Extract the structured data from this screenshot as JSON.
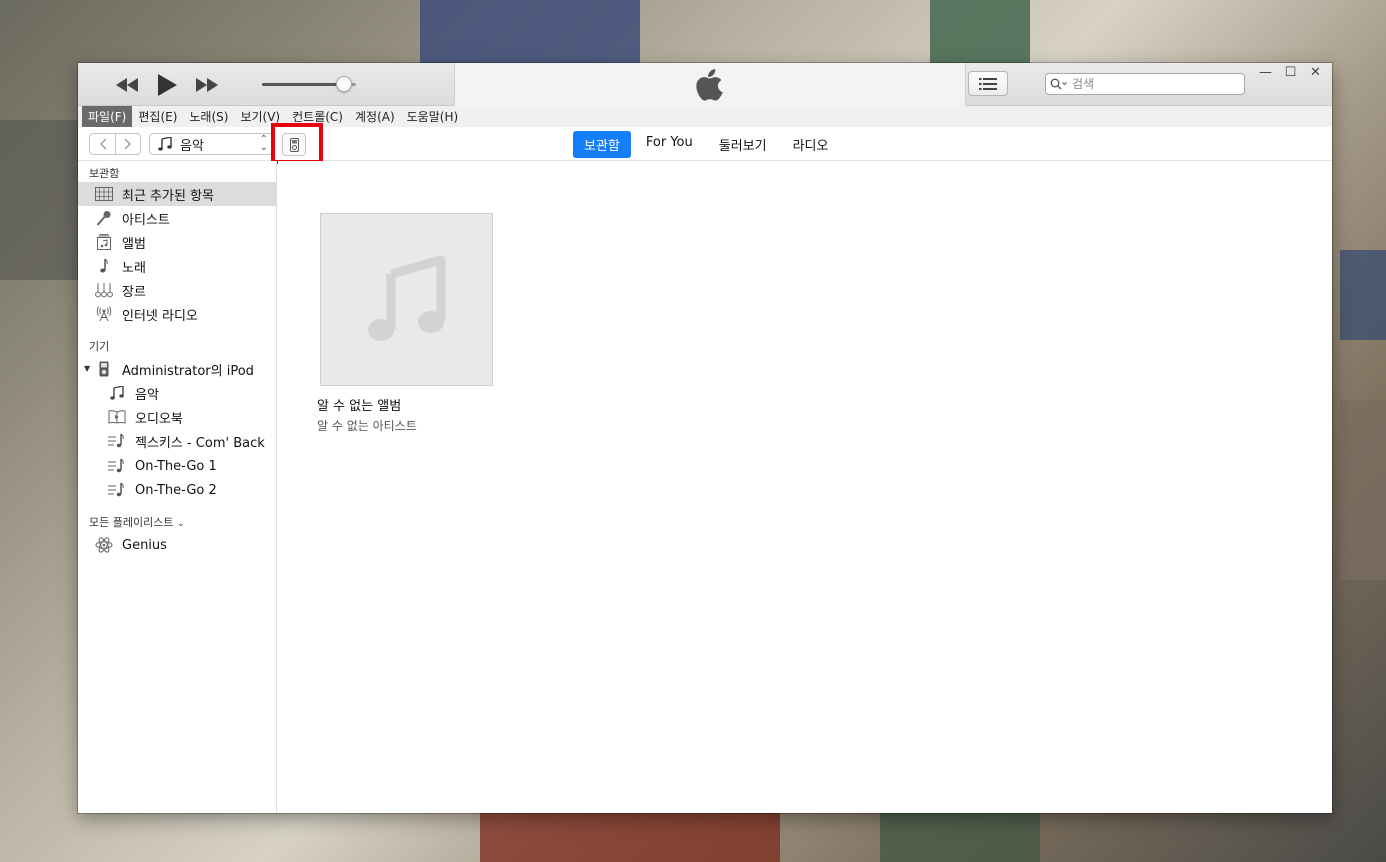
{
  "player": {
    "volume_level": 0.87
  },
  "search": {
    "placeholder": "검색"
  },
  "menu": [
    {
      "label": "파일(F)"
    },
    {
      "label": "편집(E)"
    },
    {
      "label": "노래(S)"
    },
    {
      "label": "보기(V)"
    },
    {
      "label": "컨트롤(C)"
    },
    {
      "label": "계정(A)"
    },
    {
      "label": "도움말(H)"
    }
  ],
  "toolbar": {
    "media_select": "음악",
    "tabs": [
      {
        "label": "보관함",
        "active": true
      },
      {
        "label": "For You"
      },
      {
        "label": "둘러보기"
      },
      {
        "label": "라디오"
      }
    ]
  },
  "sidebar": {
    "library_heading": "보관함",
    "library_items": [
      {
        "label": "최근 추가된 항목",
        "icon": "grid-icon",
        "selected": true
      },
      {
        "label": "아티스트",
        "icon": "microphone-icon"
      },
      {
        "label": "앨범",
        "icon": "album-icon"
      },
      {
        "label": "노래",
        "icon": "music-note-icon"
      },
      {
        "label": "장르",
        "icon": "genre-icon"
      },
      {
        "label": "인터넷 라디오",
        "icon": "radio-antenna-icon"
      }
    ],
    "devices_heading": "기기",
    "device": {
      "label": "Administrator의 iPod",
      "icon": "ipod-icon"
    },
    "device_items": [
      {
        "label": "음악",
        "icon": "music-note-icon"
      },
      {
        "label": "오디오북",
        "icon": "audiobook-icon"
      },
      {
        "label": "젝스키스 - Com' Back",
        "icon": "playlist-icon"
      },
      {
        "label": "On-The-Go 1",
        "icon": "playlist-icon"
      },
      {
        "label": "On-The-Go 2",
        "icon": "playlist-icon"
      }
    ],
    "playlists_heading": "모든 플레이리스트",
    "playlist_items": [
      {
        "label": "Genius",
        "icon": "genius-atom-icon"
      }
    ]
  },
  "main": {
    "album": {
      "title": "알 수 없는 앨범",
      "artist": "알 수 없는 아티스트"
    }
  },
  "colors": {
    "accent": "#157efb",
    "highlight_box": "#e8000b"
  }
}
